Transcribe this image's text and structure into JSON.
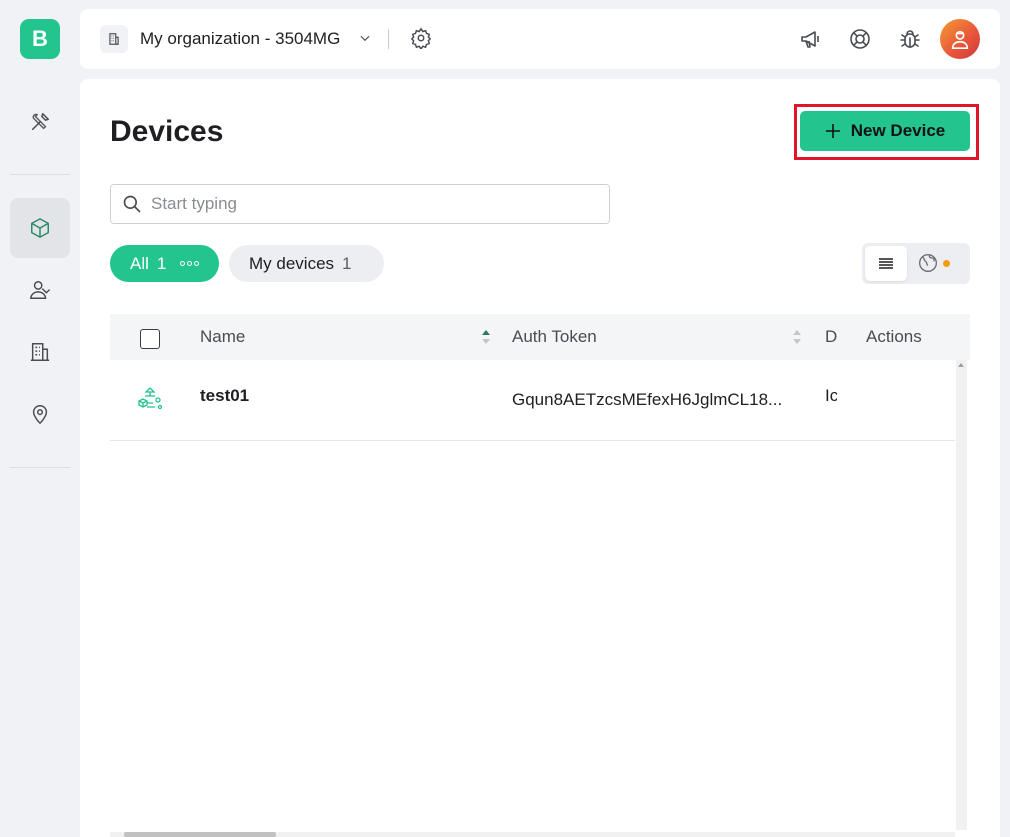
{
  "app": {
    "logo_letter": "B",
    "brand_color": "#23c48e"
  },
  "sidebar": {
    "items": [
      {
        "name": "tools",
        "icon": "tools-icon",
        "active": false
      },
      {
        "name": "devices",
        "icon": "cube-icon",
        "active": true
      },
      {
        "name": "users",
        "icon": "users-icon",
        "active": false
      },
      {
        "name": "organizations",
        "icon": "building-icon",
        "active": false
      },
      {
        "name": "locations",
        "icon": "location-pin-icon",
        "active": false
      }
    ]
  },
  "header": {
    "org_name": "My organization - 3504MG",
    "icons": [
      "megaphone-icon",
      "lifebuoy-icon",
      "bug-icon",
      "avatar"
    ]
  },
  "main": {
    "title": "Devices",
    "new_device_label": "New Device",
    "highlight_color": "#e0142b",
    "search": {
      "placeholder": "Start typing",
      "value": ""
    },
    "filters": [
      {
        "label": "All",
        "count": "1",
        "selected": true
      },
      {
        "label": "My devices",
        "count": "1",
        "selected": false
      }
    ],
    "view_toggle": {
      "selected": "list",
      "options": [
        "list",
        "map"
      ]
    }
  },
  "table": {
    "columns": [
      "Name",
      "Auth Token",
      "D",
      "Actions"
    ],
    "rows": [
      {
        "name": "test01",
        "auth_token": "Gqun8AETzcsMEfexH6JglmCL18...",
        "d": "Ic"
      }
    ]
  }
}
